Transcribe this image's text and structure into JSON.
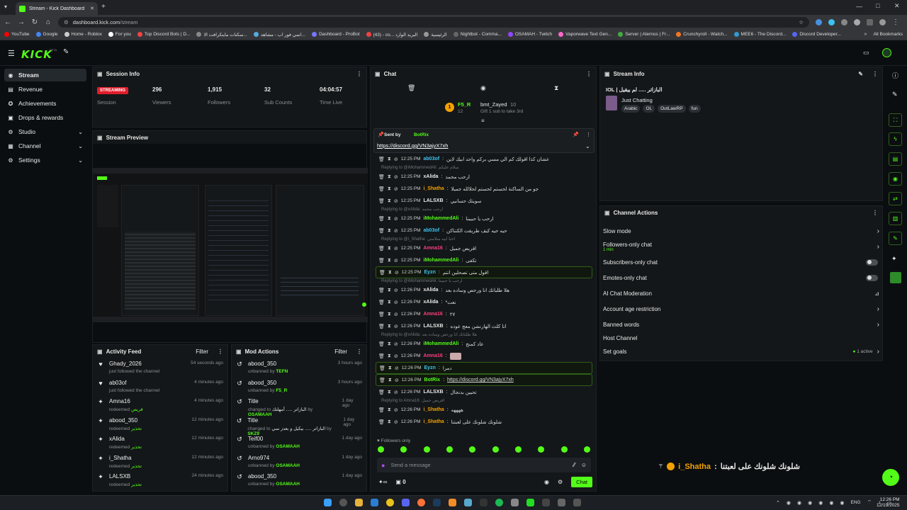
{
  "browser": {
    "tab_title": "Stream - Kick Dashboard",
    "url_host": "dashboard.kick.com",
    "url_path": "/stream",
    "bookmarks": [
      {
        "label": "YouTube",
        "color": "#ff0000"
      },
      {
        "label": "Google",
        "color": "#4285f4"
      },
      {
        "label": "Home - Roblox",
        "color": "#cccccc"
      },
      {
        "label": "For you",
        "color": "#ffffff"
      },
      {
        "label": "Top Discord Bots | D...",
        "color": "#e44"
      },
      {
        "label": "سكنات ماينكرافت الا...",
        "color": "#888"
      },
      {
        "label": "انمي فور اب - مشاهد...",
        "color": "#5ad"
      },
      {
        "label": "Dashboard - ProBot",
        "color": "#77f"
      },
      {
        "label": "(43) - os... البريد الوارد",
        "color": "#e44"
      },
      {
        "label": "الرئيسية",
        "color": "#999"
      },
      {
        "label": "Nightbot - Comma...",
        "color": "#666"
      },
      {
        "label": "OSAMAH - Twitch",
        "color": "#9146ff"
      },
      {
        "label": "Vaporwave Text Gen...",
        "color": "#f6c"
      },
      {
        "label": "Server | Aternos | Fr...",
        "color": "#4a4"
      },
      {
        "label": "Crunchyroll - Watch...",
        "color": "#f47521"
      },
      {
        "label": "MEE6 - The Discord...",
        "color": "#39c"
      },
      {
        "label": "Discord Developer...",
        "color": "#5865f2"
      }
    ],
    "all_bookmarks": "All Bookmarks"
  },
  "sidebar": {
    "items": [
      {
        "label": "Stream",
        "icon": "stream-icon",
        "active": true,
        "glyph": "◉"
      },
      {
        "label": "Revenue",
        "icon": "revenue-icon",
        "glyph": "▤"
      },
      {
        "label": "Achievements",
        "icon": "trophy-icon",
        "glyph": "✪"
      },
      {
        "label": "Drops & rewards",
        "icon": "gift-icon",
        "glyph": "▣"
      },
      {
        "label": "Studio",
        "icon": "studio-icon",
        "glyph": "⚙",
        "chevron": true
      },
      {
        "label": "Channel",
        "icon": "channel-icon",
        "glyph": "▦",
        "chevron": true
      },
      {
        "label": "Settings",
        "icon": "settings-icon",
        "glyph": "⚙",
        "chevron": true
      }
    ]
  },
  "session": {
    "title": "Session Info",
    "status": "STREAMING",
    "status_label": "Session",
    "stats": [
      {
        "value": "296",
        "label": "Viewers"
      },
      {
        "value": "1,915",
        "label": "Followers"
      },
      {
        "value": "32",
        "label": "Sub Counts"
      },
      {
        "value": "04:04:57",
        "label": "Time Live"
      }
    ]
  },
  "preview": {
    "title": "Stream Preview"
  },
  "activity": {
    "title": "Activity Feed",
    "filter": "Filter",
    "items": [
      {
        "user": "Ghady_2026",
        "sub": "just followed the channel",
        "ago": "54 seconds ago",
        "icon": "heart-icon",
        "glyph": "♥"
      },
      {
        "user": "ab03of",
        "sub": "just followed the channel",
        "ago": "4 minutes ago",
        "icon": "heart-icon",
        "glyph": "♥"
      },
      {
        "user": "Amna16",
        "sub": "redeemed",
        "reward": "قريص",
        "ago": "4 minutes ago",
        "icon": "points-icon",
        "glyph": "✦"
      },
      {
        "user": "abood_350",
        "sub": "redeemed",
        "reward": "تحذير",
        "ago": "12 minutes ago",
        "icon": "points-icon",
        "glyph": "✦"
      },
      {
        "user": "xAlida",
        "sub": "redeemed",
        "reward": "تحذير",
        "ago": "12 minutes ago",
        "icon": "points-icon",
        "glyph": "✦"
      },
      {
        "user": "i_Shatha",
        "sub": "redeemed",
        "reward": "تحذير",
        "ago": "12 minutes ago",
        "icon": "points-icon",
        "glyph": "✦"
      },
      {
        "user": "LALSXB",
        "sub": "redeemed",
        "reward": "تحذير",
        "ago": "24 minutes ago",
        "icon": "points-icon",
        "glyph": "✦"
      }
    ]
  },
  "modactions": {
    "title": "Mod Actions",
    "filter": "Filter",
    "items": [
      {
        "user": "abood_350",
        "sub": "unbanned by",
        "by": "TEFN",
        "ago": "3 hours ago"
      },
      {
        "user": "abood_350",
        "sub": "unbanned by",
        "by": "F5_R",
        "ago": "3 hours ago"
      },
      {
        "user": "Title",
        "sub": "changed to",
        "mid": "البازاتر ..... أمهلتك ",
        "by_prefix": "by",
        "by": "OSAMAAH",
        "ago": "1 day ago"
      },
      {
        "user": "Title",
        "sub": "changed to",
        "mid": "البازاتر ..... بيكيل و بعدز سي",
        "by_prefix": "by",
        "by": "SKZ9",
        "ago": "1 day ago"
      },
      {
        "user": "Teif00",
        "sub": "unbanned by",
        "by": "OSAMAAH",
        "ago": "1 day ago"
      },
      {
        "user": "Arno974",
        "sub": "unbanned by",
        "by": "OSAMAAH",
        "ago": "1 day ago"
      },
      {
        "user": "abood_350",
        "sub": "unbanned by",
        "by": "OSAMAAH",
        "ago": "1 day ago"
      }
    ]
  },
  "chat": {
    "title": "Chat",
    "gift_user": "F5_R",
    "gift_target": "bmt_Zayed",
    "gift_count": "10",
    "gift_rank": "12",
    "gift_text": "Gift 1 sub to take 3rd",
    "pinned_sent_by": "Sent by",
    "pinned_user": "BotRix",
    "pinned_link": "https://discord.gg/VN3ajyX7xh",
    "messages": [
      {
        "type": "msg",
        "time": "12:25 PM",
        "user": "ab03of",
        "color": "#3cc3f0",
        "text": "عشان كذا اقولك كم الي مسي بركم واحد ابيك لاين"
      },
      {
        "type": "reply",
        "text": "Replying to @iMohammedAli: سلام عليكم"
      },
      {
        "type": "msg",
        "time": "12:25 PM",
        "user": "xAlida",
        "color": "#e8e8e8",
        "text": "ارحب محمد"
      },
      {
        "type": "msg",
        "time": "12:25 PM",
        "user": "i_Shatha",
        "color": "#f2a100",
        "text": "جو من الساكنة لحستم لحستم لحلالله جميلا"
      },
      {
        "type": "msg",
        "time": "12:25 PM",
        "user": "LALSXB",
        "color": "#e8e8e8",
        "text": "سويتك حسانيي"
      },
      {
        "type": "reply",
        "text": "Replying to @xAlida: ارحب محمد"
      },
      {
        "type": "msg",
        "time": "12:25 PM",
        "user": "iMohammedAli",
        "color": "#53fc18",
        "text": "ارحب يا حبيبنا"
      },
      {
        "type": "msg",
        "time": "12:25 PM",
        "user": "ab03of",
        "color": "#3cc3f0",
        "text": "حيه حيه كيف طريقت الكنتاكن"
      },
      {
        "type": "reply",
        "text": "Replying to @i_Shatha: احنا ابيه سلامتي"
      },
      {
        "type": "msg",
        "time": "12:25 PM",
        "user": "Amna16",
        "color": "#ff3d7f",
        "text": "اقريص جميل"
      },
      {
        "type": "msg",
        "time": "12:25 PM",
        "user": "iMohammedAli",
        "color": "#53fc18",
        "text": "تكفى"
      },
      {
        "type": "msg",
        "time": "12:25 PM",
        "user": "Eyzn",
        "color": "#3cc3f0",
        "text": "اقول متى تصحلين انتم",
        "hl": true
      },
      {
        "type": "reply",
        "text": "Replying to @iMohammedAli: ارحب يا حبيبنا"
      },
      {
        "type": "msg",
        "time": "12:26 PM",
        "user": "xAlida",
        "color": "#e8e8e8",
        "text": "هلا طلباتك انا ورحص وساده بعد"
      },
      {
        "type": "msg",
        "time": "12:26 PM",
        "user": "xAlida",
        "color": "#e8e8e8",
        "text": "*نعت"
      },
      {
        "type": "msg",
        "time": "12:26 PM",
        "user": "Amna16",
        "color": "#ff3d7f",
        "text": "٢٧"
      },
      {
        "type": "msg",
        "time": "12:26 PM",
        "user": "LALSXB",
        "color": "#e8e8e8",
        "text": "انا كلث الهارنشن معج عوده"
      },
      {
        "type": "reply",
        "text": "Replying to @xAlida: هلا طلباتك انا ورحص وساده بعد"
      },
      {
        "type": "msg",
        "time": "12:26 PM",
        "user": "iMohammedAli",
        "color": "#53fc18",
        "text": "عاد كمنج"
      },
      {
        "type": "msg",
        "time": "12:26 PM",
        "user": "Amna16",
        "color": "#ff3d7f",
        "text": "[emote]"
      },
      {
        "type": "msg",
        "time": "12:26 PM",
        "user": "Eyzn",
        "color": "#3cc3f0",
        "text": "دمرا",
        "hl": true
      },
      {
        "type": "msg",
        "time": "12:26 PM",
        "user": "BotRix",
        "color": "#53fc18",
        "text": "https://discord.gg/VN3ajyX7xh",
        "hl": true
      },
      {
        "type": "msg",
        "time": "12:26 PM",
        "user": "LALSXB",
        "color": "#e8e8e8",
        "text": "تحيين بدنجال"
      },
      {
        "type": "reply",
        "text": "Replying to Amna16: اقريص جميل"
      },
      {
        "type": "msg",
        "time": "12:26 PM",
        "user": "i_Shatha",
        "color": "#f2a100",
        "text": "ههههه"
      },
      {
        "type": "msg",
        "time": "12:26 PM",
        "user": "i_Shatha",
        "color": "#f2a100",
        "text": "شلونك شلونك على لعبتنا"
      }
    ],
    "followers_only": "Followers only",
    "placeholder": "Send a message",
    "points": "0",
    "send": "Chat"
  },
  "streaminfo": {
    "title": "Stream Info",
    "stream_title": "IOL | البازاتر ..... لم بيقيل",
    "category": "Just Chatting",
    "tags": [
      "Arabic",
      "OL",
      "OutLawRP",
      "fun"
    ]
  },
  "channel_actions": {
    "title": "Channel Actions",
    "items": [
      {
        "label": "Slow mode",
        "ctl": "arrow"
      },
      {
        "label": "Followers-only chat",
        "sub": "1 min",
        "ctl": "arrow"
      },
      {
        "label": "Subscribers-only chat",
        "ctl": "toggle"
      },
      {
        "label": "Emotes-only chat",
        "ctl": "toggle"
      },
      {
        "label": "AI Chat Moderation",
        "ctl": "chart"
      },
      {
        "label": "Account age restriction",
        "ctl": "arrow"
      },
      {
        "label": "Banned words",
        "ctl": "arrow"
      },
      {
        "label": "Host Channel",
        "ctl": "none"
      },
      {
        "label": "Set goals",
        "ctl": "arrow",
        "status": "1 active"
      }
    ]
  },
  "overlay_msg": {
    "user": "i_Shatha",
    "text": "شلونك شلونك على لعبتنا"
  },
  "taskbar": {
    "lang": "ENG",
    "time": "12:26 PM",
    "date": "12/19/2025"
  }
}
